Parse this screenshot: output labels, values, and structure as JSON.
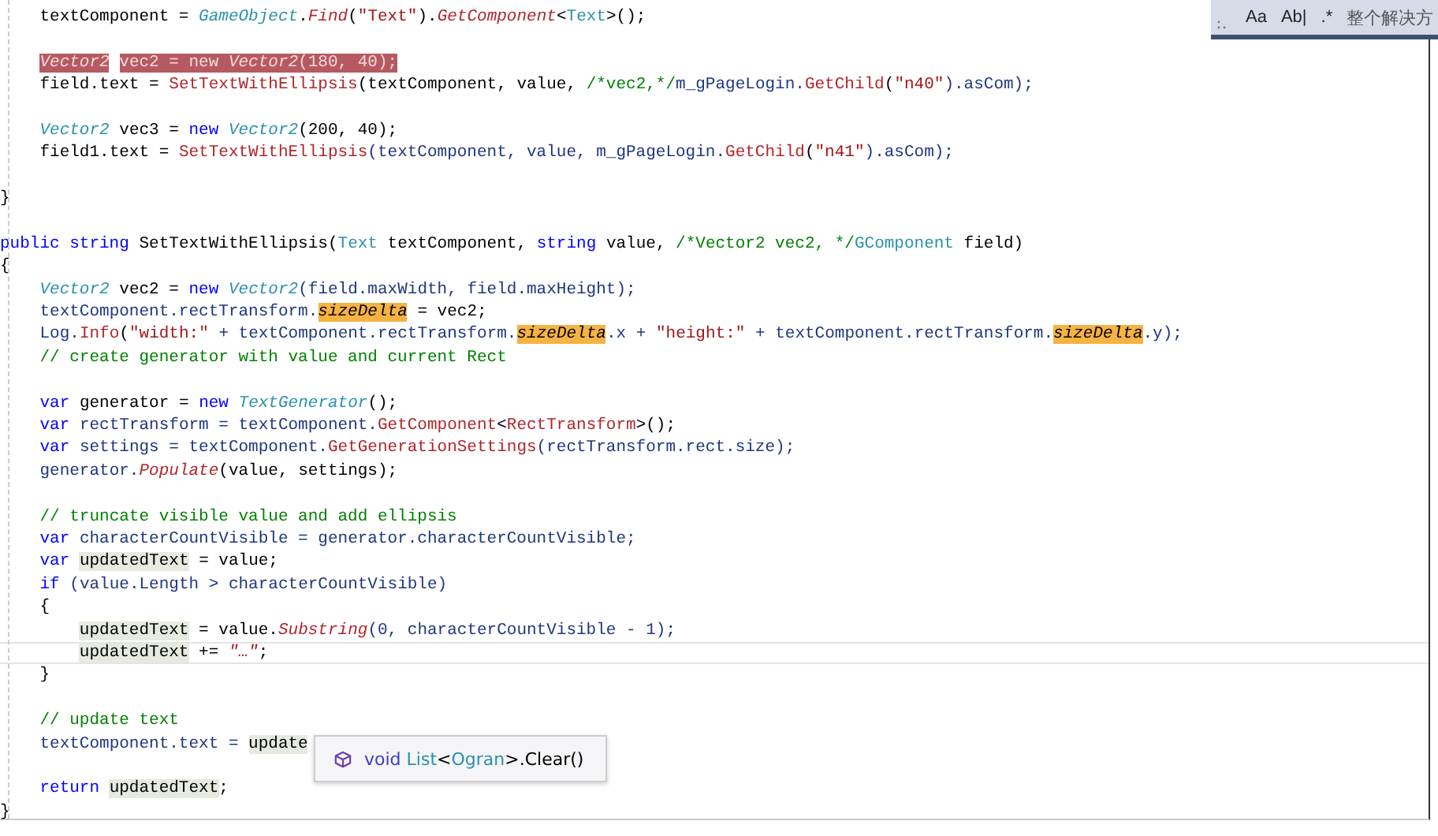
{
  "editor": {
    "lines": [
      {
        "kind": "code",
        "tokens": [
          {
            "text": "    textComponent = ",
            "kind": "plain"
          },
          {
            "text": "GameObject",
            "kind": "type-static"
          },
          {
            "text": ".",
            "kind": "plain"
          },
          {
            "text": "Find",
            "kind": "method-static"
          },
          {
            "text": "(",
            "kind": "plain"
          },
          {
            "text": "\"Text\"",
            "kind": "string"
          },
          {
            "text": ").",
            "kind": "plain"
          },
          {
            "text": "GetComponent",
            "kind": "method-static"
          },
          {
            "text": "<",
            "kind": "plain"
          },
          {
            "text": "Text",
            "kind": "type"
          },
          {
            "text": ">();",
            "kind": "plain"
          }
        ]
      },
      {
        "kind": "blank"
      },
      {
        "kind": "breakpoint",
        "tokens": [
          {
            "text": "    Vector2",
            "kind": "sel-italic"
          },
          {
            "text": " vec2 = new ",
            "kind": "sel"
          },
          {
            "text": "Vector2",
            "kind": "sel-italic"
          },
          {
            "text": "(180, 40);",
            "kind": "sel"
          }
        ]
      },
      {
        "kind": "code",
        "tokens": [
          {
            "text": "    field.text = ",
            "kind": "plain"
          },
          {
            "text": "SetTextWithEllipsis",
            "kind": "method"
          },
          {
            "text": "(textComponent, value, ",
            "kind": "plain"
          },
          {
            "text": "/*vec2,*/",
            "kind": "comment"
          },
          {
            "text": "m_gPageLogin.",
            "kind": "member"
          },
          {
            "text": "GetChild",
            "kind": "method"
          },
          {
            "text": "(",
            "kind": "plain"
          },
          {
            "text": "\"n40\"",
            "kind": "string"
          },
          {
            "text": ").asCom);",
            "kind": "member"
          }
        ]
      },
      {
        "kind": "blank"
      },
      {
        "kind": "code",
        "tokens": [
          {
            "text": "    Vector2",
            "kind": "type-static"
          },
          {
            "text": " vec3 = ",
            "kind": "plain"
          },
          {
            "text": "new ",
            "kind": "keyword"
          },
          {
            "text": "Vector2",
            "kind": "type-static"
          },
          {
            "text": "(200, 40);",
            "kind": "plain"
          }
        ]
      },
      {
        "kind": "code",
        "tokens": [
          {
            "text": "    field1.text = ",
            "kind": "plain"
          },
          {
            "text": "SetTextWithEllipsis",
            "kind": "method"
          },
          {
            "text": "(textComponent, value, m_gPageLogin.",
            "kind": "member"
          },
          {
            "text": "GetChild",
            "kind": "method"
          },
          {
            "text": "(",
            "kind": "plain"
          },
          {
            "text": "\"n41\"",
            "kind": "string"
          },
          {
            "text": ").asCom);",
            "kind": "member"
          }
        ]
      },
      {
        "kind": "blank"
      },
      {
        "kind": "code",
        "tokens": [
          {
            "text": "}",
            "kind": "plain"
          }
        ]
      },
      {
        "kind": "blank"
      },
      {
        "kind": "code",
        "tokens": [
          {
            "text": "public string",
            "kind": "keyword"
          },
          {
            "text": " SetTextWithEllipsis(",
            "kind": "plain"
          },
          {
            "text": "Text",
            "kind": "type"
          },
          {
            "text": " textComponent, ",
            "kind": "plain"
          },
          {
            "text": "string",
            "kind": "keyword"
          },
          {
            "text": " value, ",
            "kind": "plain"
          },
          {
            "text": "/*Vector2 vec2, */",
            "kind": "comment"
          },
          {
            "text": "GComponent",
            "kind": "type"
          },
          {
            "text": " field)",
            "kind": "plain"
          }
        ]
      },
      {
        "kind": "code",
        "tokens": [
          {
            "text": "{",
            "kind": "plain"
          }
        ]
      },
      {
        "kind": "code",
        "tokens": [
          {
            "text": "    Vector2",
            "kind": "type-static"
          },
          {
            "text": " vec2 = ",
            "kind": "plain"
          },
          {
            "text": "new ",
            "kind": "keyword"
          },
          {
            "text": "Vector2",
            "kind": "type-static"
          },
          {
            "text": "(field.maxWidth, field.maxHeight);",
            "kind": "member"
          }
        ]
      },
      {
        "kind": "code",
        "tokens": [
          {
            "text": "    textComponent.rectTransform.",
            "kind": "member"
          },
          {
            "text": "sizeDelta",
            "kind": "hl-static"
          },
          {
            "text": " = vec2;",
            "kind": "plain"
          }
        ]
      },
      {
        "kind": "code",
        "tokens": [
          {
            "text": "    Log.",
            "kind": "member"
          },
          {
            "text": "Info",
            "kind": "method"
          },
          {
            "text": "(",
            "kind": "plain"
          },
          {
            "text": "\"width:\"",
            "kind": "string"
          },
          {
            "text": " + textComponent.rectTransform.",
            "kind": "member"
          },
          {
            "text": "sizeDelta",
            "kind": "hl-static"
          },
          {
            "text": ".x + ",
            "kind": "member"
          },
          {
            "text": "\"height:\"",
            "kind": "string"
          },
          {
            "text": " + textComponent.rectTransform.",
            "kind": "member"
          },
          {
            "text": "sizeDelta",
            "kind": "hl-static"
          },
          {
            "text": ".y);",
            "kind": "member"
          }
        ]
      },
      {
        "kind": "code",
        "tokens": [
          {
            "text": "    // create generator with value and current Rect",
            "kind": "comment"
          }
        ]
      },
      {
        "kind": "blank"
      },
      {
        "kind": "code",
        "tokens": [
          {
            "text": "    var",
            "kind": "keyword"
          },
          {
            "text": " generator = ",
            "kind": "plain"
          },
          {
            "text": "new ",
            "kind": "keyword"
          },
          {
            "text": "TextGenerator",
            "kind": "type-static"
          },
          {
            "text": "();",
            "kind": "plain"
          }
        ]
      },
      {
        "kind": "code",
        "tokens": [
          {
            "text": "    var",
            "kind": "keyword"
          },
          {
            "text": " rectTransform = textComponent.",
            "kind": "member"
          },
          {
            "text": "GetComponent",
            "kind": "method"
          },
          {
            "text": "<",
            "kind": "plain"
          },
          {
            "text": "RectTransform",
            "kind": "method"
          },
          {
            "text": ">();",
            "kind": "plain"
          }
        ]
      },
      {
        "kind": "code",
        "tokens": [
          {
            "text": "    var",
            "kind": "keyword"
          },
          {
            "text": " settings = textComponent.",
            "kind": "member"
          },
          {
            "text": "GetGenerationSettings",
            "kind": "method"
          },
          {
            "text": "(rectTransform.rect.size);",
            "kind": "member"
          }
        ]
      },
      {
        "kind": "code",
        "tokens": [
          {
            "text": "    generator.",
            "kind": "member"
          },
          {
            "text": "Populate",
            "kind": "method-static"
          },
          {
            "text": "(value, settings);",
            "kind": "plain"
          }
        ]
      },
      {
        "kind": "blank"
      },
      {
        "kind": "code",
        "tokens": [
          {
            "text": "    // truncate visible value and add ellipsis",
            "kind": "comment"
          }
        ]
      },
      {
        "kind": "code",
        "tokens": [
          {
            "text": "    var",
            "kind": "keyword"
          },
          {
            "text": " characterCountVisible = generator.characterCountVisible;",
            "kind": "member"
          }
        ]
      },
      {
        "kind": "code",
        "tokens": [
          {
            "text": "    var ",
            "kind": "keyword"
          },
          {
            "text": "updatedText",
            "kind": "ref"
          },
          {
            "text": " = value;",
            "kind": "plain"
          }
        ]
      },
      {
        "kind": "code",
        "tokens": [
          {
            "text": "    if",
            "kind": "keyword"
          },
          {
            "text": " (value.Length > characterCountVisible)",
            "kind": "member"
          }
        ]
      },
      {
        "kind": "code",
        "tokens": [
          {
            "text": "    {",
            "kind": "plain"
          }
        ]
      },
      {
        "kind": "code",
        "tokens": [
          {
            "text": "        updatedText",
            "kind": "ref"
          },
          {
            "text": " = value.",
            "kind": "plain"
          },
          {
            "text": "Substring",
            "kind": "method-static"
          },
          {
            "text": "(0, characterCountVisible - 1);",
            "kind": "member"
          }
        ]
      },
      {
        "kind": "current",
        "tokens": [
          {
            "text": "        updatedText",
            "kind": "ref"
          },
          {
            "text": " += ",
            "kind": "plain"
          },
          {
            "text": "\"…\"",
            "kind": "string-static"
          },
          {
            "text": ";",
            "kind": "plain"
          }
        ]
      },
      {
        "kind": "code",
        "tokens": [
          {
            "text": "    }",
            "kind": "plain"
          }
        ]
      },
      {
        "kind": "blank"
      },
      {
        "kind": "code",
        "tokens": [
          {
            "text": "    // update text",
            "kind": "comment"
          }
        ]
      },
      {
        "kind": "code",
        "tokens": [
          {
            "text": "    textComponent.text = ",
            "kind": "member"
          },
          {
            "text": "update",
            "kind": "ref"
          }
        ]
      },
      {
        "kind": "blank"
      },
      {
        "kind": "code",
        "tokens": [
          {
            "text": "    return ",
            "kind": "keyword"
          },
          {
            "text": "updatedText",
            "kind": "ref"
          },
          {
            "text": ";",
            "kind": "plain"
          }
        ]
      },
      {
        "kind": "code",
        "tokens": [
          {
            "text": "}",
            "kind": "plain"
          }
        ]
      }
    ]
  },
  "find_bar": {
    "toggles": [
      "Aa",
      "Ab|",
      ".*"
    ],
    "scope": "整个解决方"
  },
  "tooltip": {
    "tokens": [
      {
        "text": "void",
        "kind": "keyword"
      },
      {
        "text": " List",
        "kind": "type"
      },
      {
        "text": "<",
        "kind": "plain"
      },
      {
        "text": "Ogran",
        "kind": "type"
      },
      {
        "text": ">.Clear()",
        "kind": "plain"
      }
    ]
  }
}
